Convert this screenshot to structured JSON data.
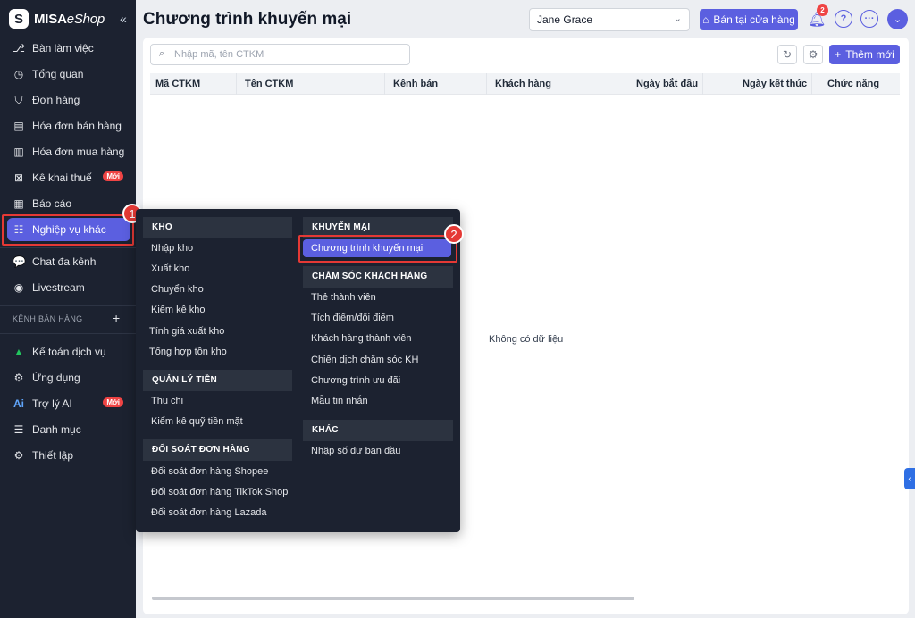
{
  "sidebar": {
    "logo_mark": "S",
    "logo_brand": "MISA",
    "logo_product": "eShop",
    "collapse": "«",
    "items": [
      {
        "label": "Bàn làm việc"
      },
      {
        "label": "Tổng quan"
      },
      {
        "label": "Đơn hàng"
      },
      {
        "label": "Hóa đơn bán hàng"
      },
      {
        "label": "Hóa đơn mua hàng"
      },
      {
        "label": "Kê khai thuế",
        "badge": "Mới"
      },
      {
        "label": "Báo cáo"
      },
      {
        "label": "Nghiệp vụ khác"
      },
      {
        "label": "Chat đa kênh"
      },
      {
        "label": "Livestream"
      }
    ],
    "section_label": "KÊNH BÁN HÀNG",
    "section_plus": "+",
    "bottom_items": [
      {
        "label": "Kế toán dịch vụ"
      },
      {
        "label": "Ứng dụng"
      },
      {
        "label": "Trợ lý AI",
        "badge": "Mới"
      },
      {
        "label": "Danh mục"
      },
      {
        "label": "Thiết lập"
      }
    ]
  },
  "header": {
    "title": "Chương trình khuyến mại",
    "user": "Jane Grace",
    "store_button": "Bán tại cửa hàng",
    "bell_count": "2",
    "help": "?",
    "more": "···"
  },
  "toolbar": {
    "search_placeholder": "Nhập mã, tên CTKM",
    "add_label": "Thêm mới"
  },
  "table": {
    "columns": [
      "Mã CTKM",
      "Tên CTKM",
      "Kênh bán",
      "Khách hàng",
      "Ngày bắt đầu",
      "Ngày kết thúc",
      "Chức năng"
    ],
    "empty_text": "Không có dữ liệu"
  },
  "menu": {
    "left": [
      {
        "group": "KHO",
        "items": [
          "Nhập kho",
          "Xuất kho",
          "Chuyển kho",
          "Kiểm kê kho",
          "Tính giá xuất kho",
          "Tổng hợp tồn kho"
        ]
      },
      {
        "group": "QUẢN LÝ TIỀN",
        "items": [
          "Thu chi",
          "Kiểm kê quỹ tiền mặt"
        ]
      },
      {
        "group": "ĐỐI SOÁT ĐƠN HÀNG",
        "items": [
          "Đối soát đơn hàng Shopee",
          "Đối soát đơn hàng TikTok Shop",
          "Đối soát đơn hàng Lazada"
        ]
      }
    ],
    "right": [
      {
        "group": "KHUYẾN MẠI",
        "items": [
          "Chương trình khuyến mại"
        ]
      },
      {
        "group": "CHĂM SÓC KHÁCH HÀNG",
        "items": [
          "Thẻ thành viên",
          "Tích điểm/đổi điểm",
          "Khách hàng thành viên",
          "Chiến dịch chăm sóc KH",
          "Chương trình ưu đãi",
          "Mẫu tin nhắn"
        ]
      },
      {
        "group": "KHÁC",
        "items": [
          "Nhập số dư ban đầu"
        ]
      }
    ]
  },
  "steps": [
    "1",
    "2"
  ],
  "colors": {
    "accent": "#5b5fe0",
    "sidebar": "#1c2230",
    "annotation": "#e53935"
  }
}
